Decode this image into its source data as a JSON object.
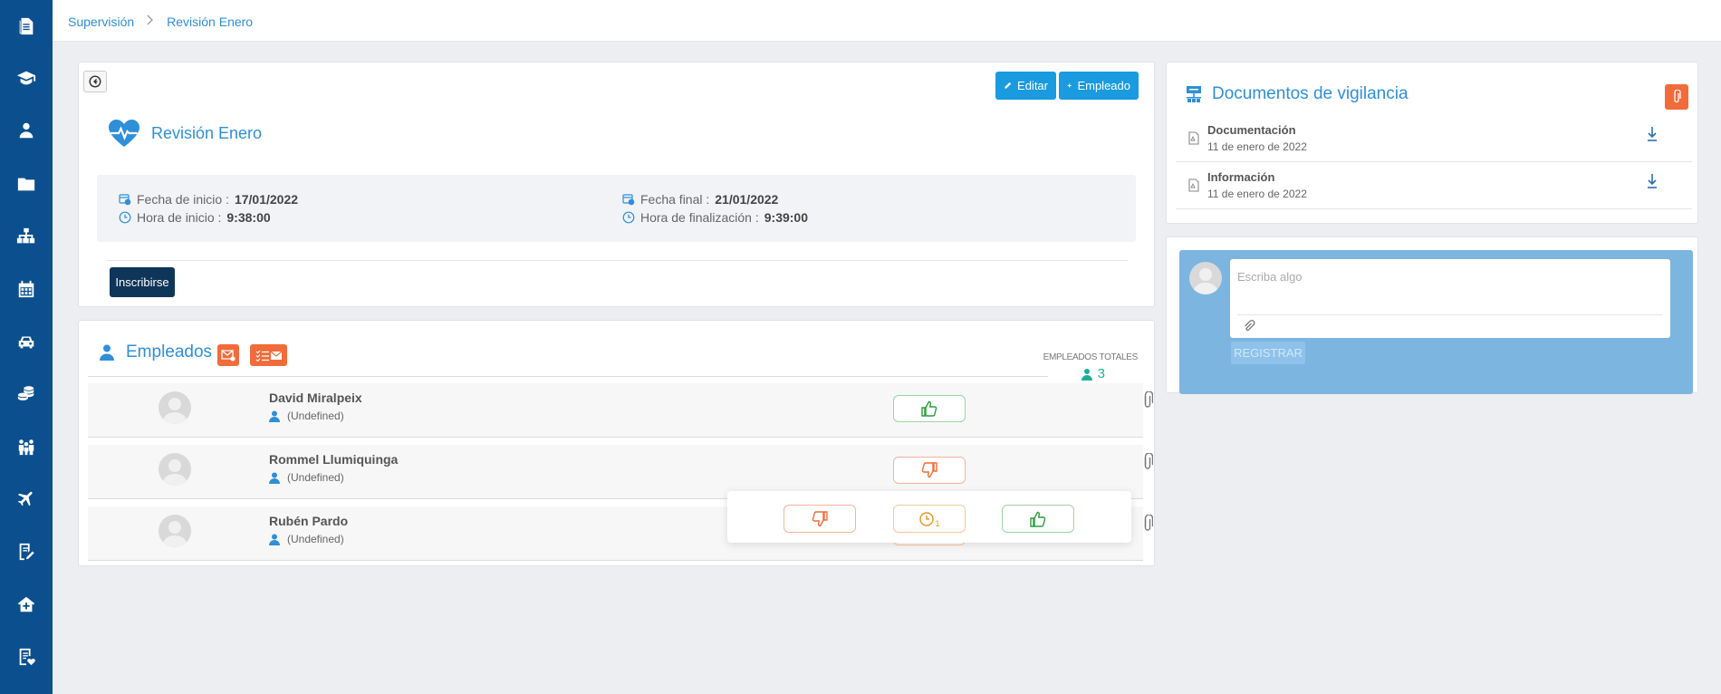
{
  "sidebar": {
    "items": [
      {
        "icon": "document-icon"
      },
      {
        "icon": "graduation-cap-icon"
      },
      {
        "icon": "user-tie-icon"
      },
      {
        "icon": "folder-icon"
      },
      {
        "icon": "org-chart-icon"
      },
      {
        "icon": "calendar-icon"
      },
      {
        "icon": "car-icon"
      },
      {
        "icon": "coins-icon"
      },
      {
        "icon": "people-icon"
      },
      {
        "icon": "plane-icon"
      },
      {
        "icon": "edit-document-icon"
      },
      {
        "icon": "house-medical-icon"
      },
      {
        "icon": "document-heart-icon"
      }
    ]
  },
  "breadcrumb": {
    "items": [
      "Supervisión",
      "Revisión Enero"
    ]
  },
  "review": {
    "edit_label": "Editar",
    "employee_label": "Empleado",
    "title": "Revisión Enero",
    "start_date_label": "Fecha de inicio :",
    "start_date": "17/01/2022",
    "start_time_label": "Hora de inicio :",
    "start_time": "9:38:00",
    "end_date_label": "Fecha final :",
    "end_date": "21/01/2022",
    "end_time_label": "Hora de finalización :",
    "end_time": "9:39:00",
    "enroll_label": "Inscribirse"
  },
  "employees": {
    "title": "Empleados",
    "totals_label": "EMPLEADOS TOTALES",
    "total_count": "3",
    "rows": [
      {
        "name": "David Miralpeix",
        "role": "(Undefined)",
        "status": "approved"
      },
      {
        "name": "Rommel Llumiquinga",
        "role": "(Undefined)",
        "status": "rejected"
      },
      {
        "name": "Rubén Pardo",
        "role": "(Undefined)",
        "status": "pending"
      }
    ],
    "popover": {
      "pending_count": "1"
    }
  },
  "documents": {
    "title": "Documentos de vigilancia",
    "items": [
      {
        "name": "Documentación",
        "date": "11 de enero de 2022"
      },
      {
        "name": "Información",
        "date": "11 de enero de 2022"
      }
    ]
  },
  "compose": {
    "placeholder": "Escriba algo",
    "submit_label": "REGISTRAR"
  },
  "colors": {
    "sidebar": "#0b4f8e",
    "accent": "#2f8fd8",
    "button_blue": "#1a9be0",
    "button_dark": "#0f3559",
    "orange": "#f26b3a",
    "approve_green": "#2a9d3a",
    "reject_red": "#f26b3a",
    "pending_orange": "#e8951f",
    "teal": "#1bb09a"
  }
}
